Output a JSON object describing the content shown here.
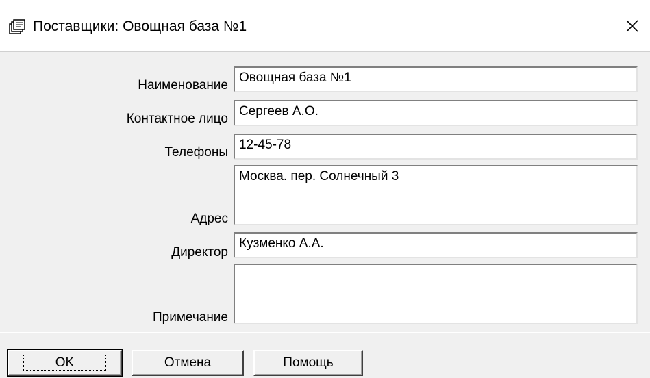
{
  "window": {
    "title": "Поставщики: Овощная база №1",
    "close_glyph": "✕",
    "title_icon": "stacked-cards-icon"
  },
  "form": {
    "fields": [
      {
        "label": "Наименование",
        "value": "Овощная база №1"
      },
      {
        "label": "Контактное лицо",
        "value": "Сергеев А.О."
      },
      {
        "label": "Телефоны",
        "value": "12-45-78"
      },
      {
        "label": "Адрес",
        "value": "Москва. пер. Солнечный 3"
      },
      {
        "label": "Директор",
        "value": "Кузменко А.А."
      },
      {
        "label": "Примечание",
        "value": ""
      }
    ]
  },
  "buttons": {
    "ok": "OK",
    "cancel": "Отмена",
    "help": "Помощь"
  }
}
